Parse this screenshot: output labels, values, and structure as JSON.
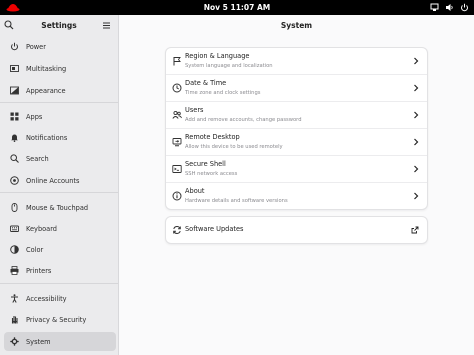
{
  "topbar": {
    "clock": "Nov 5  11:07 AM",
    "icons": [
      "redhat-logo",
      "network-icon",
      "volume-icon",
      "power-icon"
    ]
  },
  "sidebar": {
    "title": "Settings",
    "items": [
      {
        "label": "Power",
        "icon": "power-icon"
      },
      {
        "label": "Multitasking",
        "icon": "multitasking-icon"
      },
      {
        "label": "Appearance",
        "icon": "appearance-icon"
      },
      {
        "label": "Apps",
        "icon": "apps-icon"
      },
      {
        "label": "Notifications",
        "icon": "bell-icon"
      },
      {
        "label": "Search",
        "icon": "search-icon"
      },
      {
        "label": "Online Accounts",
        "icon": "online-accounts-icon"
      },
      {
        "label": "Mouse & Touchpad",
        "icon": "mouse-icon"
      },
      {
        "label": "Keyboard",
        "icon": "keyboard-icon"
      },
      {
        "label": "Color",
        "icon": "color-icon"
      },
      {
        "label": "Printers",
        "icon": "printer-icon"
      },
      {
        "label": "Accessibility",
        "icon": "accessibility-icon"
      },
      {
        "label": "Privacy & Security",
        "icon": "hand-icon"
      },
      {
        "label": "System",
        "icon": "system-icon",
        "active": true
      }
    ]
  },
  "main": {
    "title": "System",
    "rows": [
      {
        "title": "Region & Language",
        "subtitle": "System language and localization",
        "icon": "flag-icon"
      },
      {
        "title": "Date & Time",
        "subtitle": "Time zone and clock settings",
        "icon": "clock-icon"
      },
      {
        "title": "Users",
        "subtitle": "Add and remove accounts, change password",
        "icon": "users-icon"
      },
      {
        "title": "Remote Desktop",
        "subtitle": "Allow this device to be used remotely",
        "icon": "remote-desktop-icon"
      },
      {
        "title": "Secure Shell",
        "subtitle": "SSH network access",
        "icon": "terminal-icon"
      },
      {
        "title": "About",
        "subtitle": "Hardware details and software versions",
        "icon": "info-icon"
      }
    ],
    "updates": {
      "title": "Software Updates",
      "icon": "refresh-icon",
      "action_icon": "external-link-icon"
    }
  },
  "colors": {
    "sidebar_bg": "#ebebed",
    "active_bg": "#d6d6d9",
    "main_bg": "#fafafb",
    "logo_red": "#ee0000"
  }
}
